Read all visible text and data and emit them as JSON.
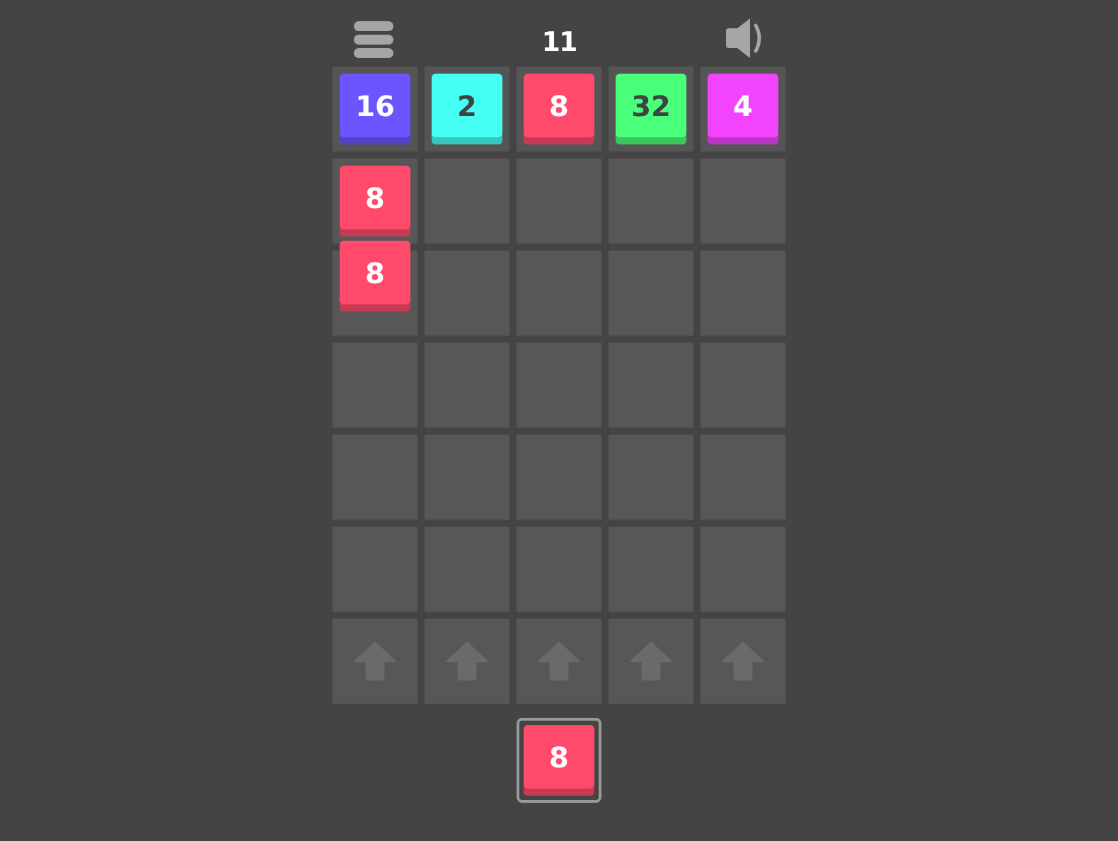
{
  "score": "11",
  "top_row": [
    {
      "value": "16",
      "color": "#6b55ff"
    },
    {
      "value": "2",
      "color": "#44fff2"
    },
    {
      "value": "8",
      "color": "#ff4a6c"
    },
    {
      "value": "32",
      "color": "#4aff7a"
    },
    {
      "value": "4",
      "color": "#f244ff"
    }
  ],
  "columns": [
    {
      "tiles": [
        {
          "value": "8",
          "color": "#ff4a6c"
        },
        {
          "value": "8",
          "color": "#ff4a6c"
        }
      ]
    },
    {},
    {},
    {},
    {}
  ],
  "next_tile": {
    "value": "8",
    "color": "#ff4a6c"
  }
}
